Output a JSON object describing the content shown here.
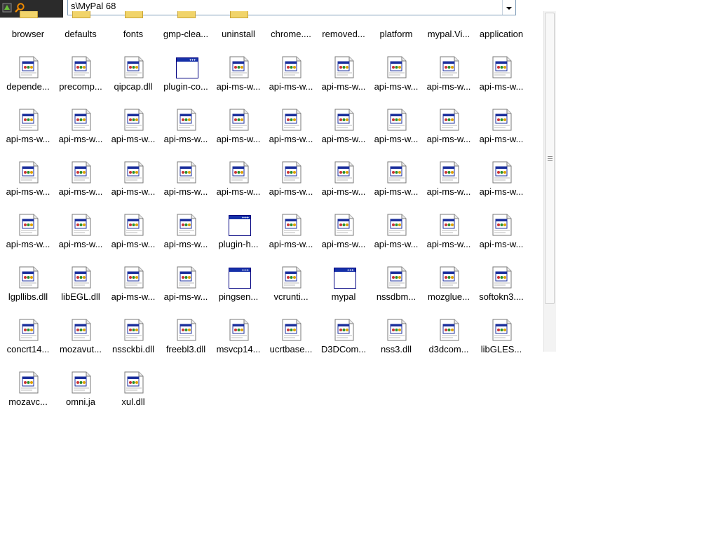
{
  "address_bar": {
    "path": "s\\MyPal 68"
  },
  "top_row": [
    "browser",
    "defaults",
    "fonts",
    "gmp-clea...",
    "uninstall",
    "chrome....",
    "removed...",
    "platform",
    "mypal.Vi...",
    "application"
  ],
  "rows": [
    [
      {
        "label": "depende...",
        "icon": "dll"
      },
      {
        "label": "precomp...",
        "icon": "dll"
      },
      {
        "label": "qipcap.dll",
        "icon": "dll"
      },
      {
        "label": "plugin-co...",
        "icon": "window"
      },
      {
        "label": "api-ms-w...",
        "icon": "dll"
      },
      {
        "label": "api-ms-w...",
        "icon": "dll"
      },
      {
        "label": "api-ms-w...",
        "icon": "dll"
      },
      {
        "label": "api-ms-w...",
        "icon": "dll"
      },
      {
        "label": "api-ms-w...",
        "icon": "dll"
      },
      {
        "label": "api-ms-w...",
        "icon": "dll"
      }
    ],
    [
      {
        "label": "api-ms-w...",
        "icon": "dll"
      },
      {
        "label": "api-ms-w...",
        "icon": "dll"
      },
      {
        "label": "api-ms-w...",
        "icon": "dll"
      },
      {
        "label": "api-ms-w...",
        "icon": "dll"
      },
      {
        "label": "api-ms-w...",
        "icon": "dll"
      },
      {
        "label": "api-ms-w...",
        "icon": "dll"
      },
      {
        "label": "api-ms-w...",
        "icon": "dll"
      },
      {
        "label": "api-ms-w...",
        "icon": "dll"
      },
      {
        "label": "api-ms-w...",
        "icon": "dll"
      },
      {
        "label": "api-ms-w...",
        "icon": "dll"
      }
    ],
    [
      {
        "label": "api-ms-w...",
        "icon": "dll"
      },
      {
        "label": "api-ms-w...",
        "icon": "dll"
      },
      {
        "label": "api-ms-w...",
        "icon": "dll"
      },
      {
        "label": "api-ms-w...",
        "icon": "dll"
      },
      {
        "label": "api-ms-w...",
        "icon": "dll"
      },
      {
        "label": "api-ms-w...",
        "icon": "dll"
      },
      {
        "label": "api-ms-w...",
        "icon": "dll"
      },
      {
        "label": "api-ms-w...",
        "icon": "dll"
      },
      {
        "label": "api-ms-w...",
        "icon": "dll"
      },
      {
        "label": "api-ms-w...",
        "icon": "dll"
      }
    ],
    [
      {
        "label": "api-ms-w...",
        "icon": "dll"
      },
      {
        "label": "api-ms-w...",
        "icon": "dll"
      },
      {
        "label": "api-ms-w...",
        "icon": "dll"
      },
      {
        "label": "api-ms-w...",
        "icon": "dll"
      },
      {
        "label": "plugin-h...",
        "icon": "window"
      },
      {
        "label": "api-ms-w...",
        "icon": "dll"
      },
      {
        "label": "api-ms-w...",
        "icon": "dll"
      },
      {
        "label": "api-ms-w...",
        "icon": "dll"
      },
      {
        "label": "api-ms-w...",
        "icon": "dll"
      },
      {
        "label": "api-ms-w...",
        "icon": "dll"
      }
    ],
    [
      {
        "label": "lgpllibs.dll",
        "icon": "dll"
      },
      {
        "label": "libEGL.dll",
        "icon": "dll"
      },
      {
        "label": "api-ms-w...",
        "icon": "dll"
      },
      {
        "label": "api-ms-w...",
        "icon": "dll"
      },
      {
        "label": "pingsen...",
        "icon": "window"
      },
      {
        "label": "vcrunti...",
        "icon": "dll"
      },
      {
        "label": "mypal",
        "icon": "window"
      },
      {
        "label": "nssdbm...",
        "icon": "dll"
      },
      {
        "label": "mozglue...",
        "icon": "dll"
      },
      {
        "label": "softokn3....",
        "icon": "dll"
      }
    ],
    [
      {
        "label": "concrt14...",
        "icon": "dll"
      },
      {
        "label": "mozavut...",
        "icon": "dll"
      },
      {
        "label": "nssckbi.dll",
        "icon": "dll"
      },
      {
        "label": "freebl3.dll",
        "icon": "dll"
      },
      {
        "label": "msvcp14...",
        "icon": "dll"
      },
      {
        "label": "ucrtbase...",
        "icon": "dll"
      },
      {
        "label": "D3DCom...",
        "icon": "dll"
      },
      {
        "label": "nss3.dll",
        "icon": "dll"
      },
      {
        "label": "d3dcom...",
        "icon": "dll"
      },
      {
        "label": "libGLES...",
        "icon": "dll"
      }
    ],
    [
      {
        "label": "mozavc...",
        "icon": "dll"
      },
      {
        "label": "omni.ja",
        "icon": "dll"
      },
      {
        "label": "xul.dll",
        "icon": "dll"
      }
    ]
  ]
}
